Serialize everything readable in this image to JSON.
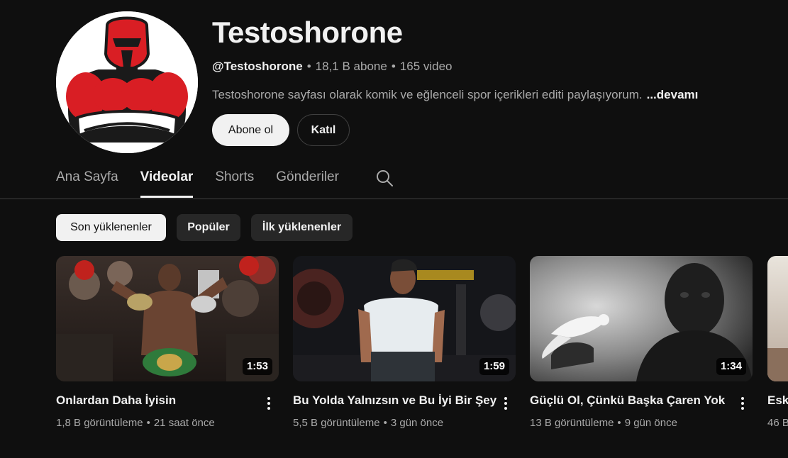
{
  "channel": {
    "name": "Testoshorone",
    "handle": "@Testoshorone",
    "subscribers": "18,1 B abone",
    "video_count": "165 video",
    "meta_separator": "•",
    "description": "Testoshorone sayfası olarak komik ve eğlenceli spor içerikleri editi paylaşıyorum.",
    "more_label": "...devamı",
    "avatar_icon": "muscle-mascot-logo",
    "subscribe_label": "Abone ol",
    "join_label": "Katıl"
  },
  "tabs": [
    {
      "label": "Ana Sayfa",
      "active": false
    },
    {
      "label": "Videolar",
      "active": true
    },
    {
      "label": "Shorts",
      "active": false
    },
    {
      "label": "Gönderiler",
      "active": false
    }
  ],
  "tab_search_icon": "search-icon",
  "chips": [
    {
      "label": "Son yüklenenler",
      "active": true
    },
    {
      "label": "Popüler",
      "active": false
    },
    {
      "label": "İlk yüklenenler",
      "active": false
    }
  ],
  "videos": [
    {
      "title": "Onlardan Daha İyisin",
      "duration": "1:53",
      "views": "1,8 B görüntüleme",
      "age": "21 saat önce",
      "meta_separator": "•"
    },
    {
      "title": "Bu Yolda Yalnızsın ve Bu İyi Bir Şey",
      "duration": "1:59",
      "views": "5,5 B görüntüleme",
      "age": "3 gün önce",
      "meta_separator": "•"
    },
    {
      "title": "Güçlü Ol, Çünkü Başka Çaren Yok",
      "duration": "1:34",
      "views": "13 B görüntüleme",
      "age": "9 gün önce",
      "meta_separator": "•"
    }
  ],
  "partial_video": {
    "title": "Esk",
    "meta": "46 B"
  },
  "colors": {
    "background": "#0f0f0f",
    "chip_bg": "#272727",
    "mascot_red": "#d91e24"
  }
}
